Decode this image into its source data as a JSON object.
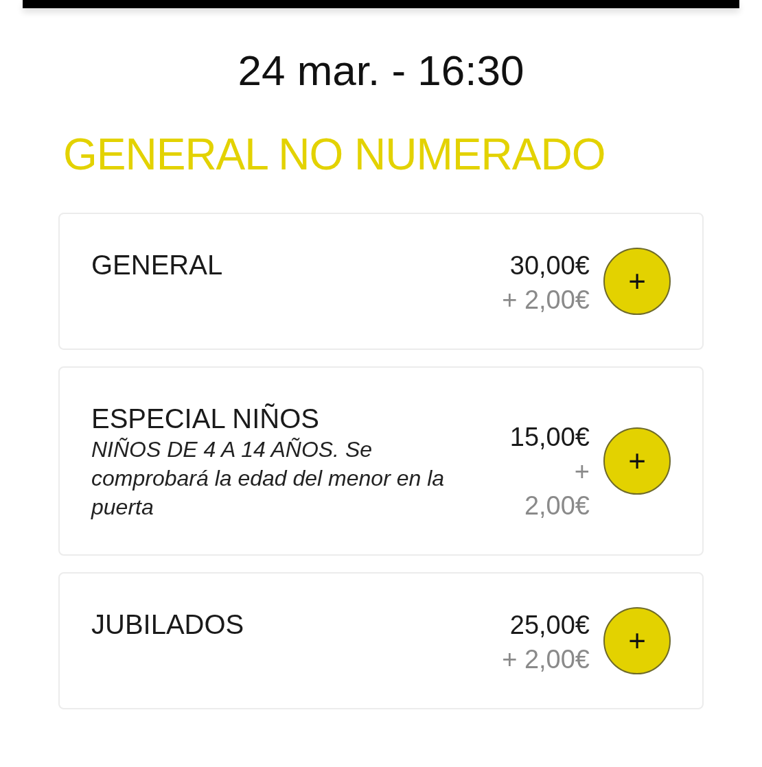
{
  "datetime": "24 mar. - 16:30",
  "section_title": "GENERAL NO NUMERADO",
  "tickets": [
    {
      "name": "GENERAL",
      "price": "30,00€",
      "fee": "+ 2,00€",
      "add_label": "+"
    },
    {
      "name": "ESPECIAL NIÑOS",
      "description": "NIÑOS DE 4 A 14 AÑOS. Se comprobará la edad del menor en la puerta",
      "price": "15,00€",
      "fee": "+ 2,00€",
      "add_label": "+"
    },
    {
      "name": "JUBILADOS",
      "price": "25,00€",
      "fee": "+ 2,00€",
      "add_label": "+"
    }
  ]
}
